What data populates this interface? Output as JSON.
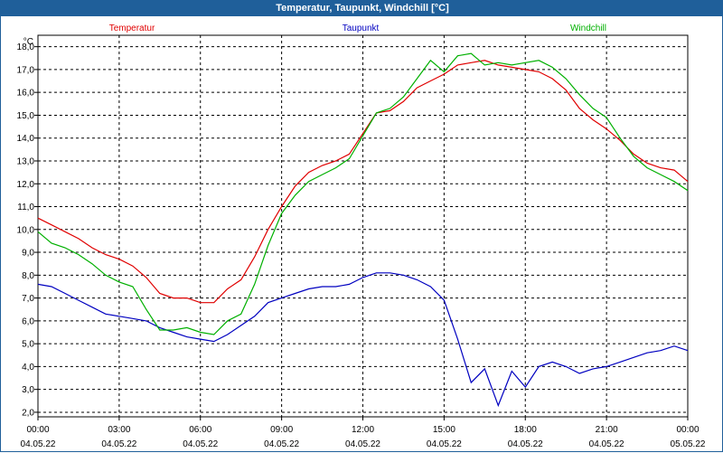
{
  "window": {
    "title": "Temperatur, Taupunkt, Windchill [°C]"
  },
  "chart_data": {
    "type": "line",
    "title": "Temperatur, Taupunkt, Windchill [°C]",
    "ylabel": "°C",
    "ylim": [
      1.8,
      18.5
    ],
    "y_ticks": [
      "2,0",
      "3,0",
      "4,0",
      "5,0",
      "6,0",
      "7,0",
      "8,0",
      "9,0",
      "10,0",
      "11,0",
      "12,0",
      "13,0",
      "14,0",
      "15,0",
      "16,0",
      "17,0",
      "18,0"
    ],
    "x_ticks": [
      {
        "time": "00:00",
        "date": "04.05.22"
      },
      {
        "time": "03:00",
        "date": "04.05.22"
      },
      {
        "time": "06:00",
        "date": "04.05.22"
      },
      {
        "time": "09:00",
        "date": "04.05.22"
      },
      {
        "time": "12:00",
        "date": "04.05.22"
      },
      {
        "time": "15:00",
        "date": "04.05.22"
      },
      {
        "time": "18:00",
        "date": "04.05.22"
      },
      {
        "time": "21:00",
        "date": "04.05.22"
      },
      {
        "time": "00:00",
        "date": "05.05.22"
      }
    ],
    "grid": true,
    "series": [
      {
        "name": "Temperatur",
        "color": "#e00000",
        "legend_pos": "left",
        "x": [
          0,
          0.5,
          1,
          1.5,
          2,
          2.5,
          3,
          3.5,
          4,
          4.5,
          5,
          5.5,
          6,
          6.5,
          7,
          7.5,
          8,
          8.5,
          9,
          9.5,
          10,
          10.5,
          11,
          11.5,
          12,
          12.5,
          13,
          13.5,
          14,
          14.5,
          15,
          15.5,
          16,
          16.5,
          17,
          17.5,
          18,
          18.5,
          19,
          19.5,
          20,
          20.5,
          21,
          21.5,
          22,
          22.5,
          23,
          23.5,
          24
        ],
        "values": [
          10.5,
          10.2,
          9.9,
          9.6,
          9.2,
          8.9,
          8.7,
          8.4,
          7.9,
          7.2,
          7.0,
          7.0,
          6.8,
          6.8,
          7.4,
          7.8,
          8.8,
          10.0,
          11.0,
          11.9,
          12.5,
          12.8,
          13.0,
          13.3,
          14.2,
          15.1,
          15.2,
          15.6,
          16.2,
          16.5,
          16.8,
          17.2,
          17.3,
          17.4,
          17.2,
          17.1,
          17.0,
          16.9,
          16.6,
          16.1,
          15.3,
          14.8,
          14.4,
          13.9,
          13.3,
          12.9,
          12.7,
          12.6,
          12.1
        ]
      },
      {
        "name": "Taupunkt",
        "color": "#0000c0",
        "legend_pos": "center",
        "x": [
          0,
          0.5,
          1,
          1.5,
          2,
          2.5,
          3,
          3.5,
          4,
          4.5,
          5,
          5.5,
          6,
          6.5,
          7,
          7.5,
          8,
          8.5,
          9,
          9.5,
          10,
          10.5,
          11,
          11.5,
          12,
          12.5,
          13,
          13.5,
          14,
          14.5,
          15,
          15.5,
          16,
          16.5,
          17,
          17.5,
          18,
          18.5,
          19,
          19.5,
          20,
          20.5,
          21,
          21.5,
          22,
          22.5,
          23,
          23.5,
          24
        ],
        "values": [
          7.6,
          7.5,
          7.2,
          6.9,
          6.6,
          6.3,
          6.2,
          6.1,
          6.0,
          5.7,
          5.5,
          5.3,
          5.2,
          5.1,
          5.4,
          5.8,
          6.2,
          6.8,
          7.0,
          7.2,
          7.4,
          7.5,
          7.5,
          7.6,
          7.9,
          8.1,
          8.1,
          8.0,
          7.8,
          7.5,
          6.9,
          5.2,
          3.3,
          3.9,
          2.3,
          3.8,
          3.1,
          4.0,
          4.2,
          4.0,
          3.7,
          3.9,
          4.0,
          4.2,
          4.4,
          4.6,
          4.7,
          4.9,
          4.7
        ]
      },
      {
        "name": "Windchill",
        "color": "#00b000",
        "legend_pos": "right",
        "x": [
          0,
          0.5,
          1,
          1.5,
          2,
          2.5,
          3,
          3.5,
          4,
          4.5,
          5,
          5.5,
          6,
          6.5,
          7,
          7.5,
          8,
          8.5,
          9,
          9.5,
          10,
          10.5,
          11,
          11.5,
          12,
          12.5,
          13,
          13.5,
          14,
          14.5,
          15,
          15.5,
          16,
          16.5,
          17,
          17.5,
          18,
          18.5,
          19,
          19.5,
          20,
          20.5,
          21,
          21.5,
          22,
          22.5,
          23,
          23.5,
          24
        ],
        "values": [
          9.9,
          9.4,
          9.2,
          8.9,
          8.5,
          8.0,
          7.7,
          7.5,
          6.5,
          5.6,
          5.6,
          5.7,
          5.5,
          5.4,
          6.0,
          6.3,
          7.6,
          9.3,
          10.7,
          11.5,
          12.1,
          12.4,
          12.7,
          13.1,
          14.1,
          15.1,
          15.3,
          15.8,
          16.6,
          17.4,
          16.9,
          17.6,
          17.7,
          17.2,
          17.3,
          17.2,
          17.3,
          17.4,
          17.1,
          16.6,
          15.9,
          15.3,
          14.9,
          14.0,
          13.2,
          12.7,
          12.4,
          12.1,
          11.7
        ]
      }
    ]
  }
}
